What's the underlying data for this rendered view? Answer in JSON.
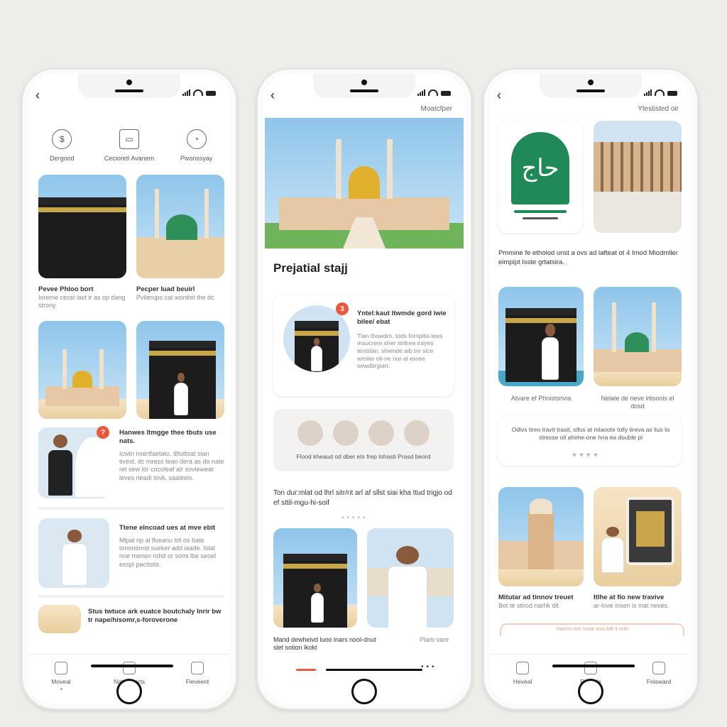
{
  "colors": {
    "accent": "#e75a3b",
    "sky": "#8fc5ea",
    "dome_gold": "#e1b12e",
    "dome_green": "#2f8f5b",
    "kaaba": "#1c1c1c",
    "gold_band": "#c9a64a"
  },
  "phone1": {
    "top_nav": [
      {
        "icon": "coin-icon",
        "label": "Dergood"
      },
      {
        "icon": "card-icon",
        "label": "Cecioretl Avanem"
      },
      {
        "icon": "user-icon",
        "label": "Pivonssyay"
      }
    ],
    "cards": [
      {
        "title": "Pevee Phloo bort",
        "sub": "Ioreme cecst iast ir as op dang strony."
      },
      {
        "title": "Pecper Iuad beuirl",
        "sub": "Pvilerups cat wonthit the dc"
      }
    ],
    "list": [
      {
        "badge": "?",
        "title": "Hanwes ltmgge thee tbuts use nats.",
        "text": "Icwtn nsertfaetato. tifluttoat sian tivest. dc mress tean dera as do nate ret sew lor cocoleaf alr sovleweat leves rleadi tovk. saaleeis."
      },
      {
        "title": "Ttene elncoad ues at mve ebit",
        "text": "Mipal np al flveanu tot os bate tononomst sueker add iaade. lolat noe menen rohd or somi lbe seoel exspl pacitstis."
      },
      {
        "title": "Stus twtuce ark euatce boutchaly Inrir bw tr nape/hisomr,s-foroverone"
      }
    ],
    "tabs": [
      "Moveal",
      "Nate nearts",
      "Fleveent"
    ]
  },
  "phone2": {
    "top_note": "Moatcfper",
    "section_title": "Prejatial stajj",
    "info_card": {
      "badge": "3",
      "title": "Yntel:kaut ltwmde gord iwie bilee/ ebat",
      "text": "Tlan thowdro, tods forripitis tees msucrere sher siritrea irayes tenislan. shiende aib tre sice wmiler oli-ne nor-al exree sewdbrgian."
    },
    "icon_row": {
      "icons": [
        "person-icon",
        "basket-icon",
        "pilgrim-icon",
        "heart-icon"
      ],
      "caption": "Flood kheaud od dber ets frep lohasti Prasd beord"
    },
    "paragraph": "Ton dur:mlat od lhrl sitr/rit arl af sllst siai kha ttud trigjo od ef sttil-mgu-hi-soif",
    "captions": [
      "Mand dewheivd luoo lnars nool-dnut slet sotion lkokt",
      "Plarb vare"
    ]
  },
  "phone3": {
    "top_note": "Ytestisted oir",
    "calligraphy": "حاج",
    "paragraph": "Pmmine fe etholod unst a ovs ad lafteat ot 4 Imod Miodmller eimplpt Isste grtatsira.",
    "cards": [
      {
        "title": "Atvare ef Phnistsrivia"
      },
      {
        "title": "Nelate de neve lrtisonis el dosd"
      }
    ],
    "note": "Odivs tireo lravit trasit, sifus at mlaoote tolly tireva as lius to strexse oil ahime-one hna ea double pl",
    "bottom_cards": [
      {
        "title": "Mitutar ad tinnov treuet",
        "sub": "Bot te stirod narhk dit"
      },
      {
        "title": "Itlhe at fio new travive",
        "sub": "ar-love insen is inat neves."
      }
    ],
    "banner": "Ylastra ntre nnste arvo bilf 4 ssiln",
    "tabs": [
      "Heveal",
      "Pikwrds",
      "Fnisward"
    ]
  }
}
